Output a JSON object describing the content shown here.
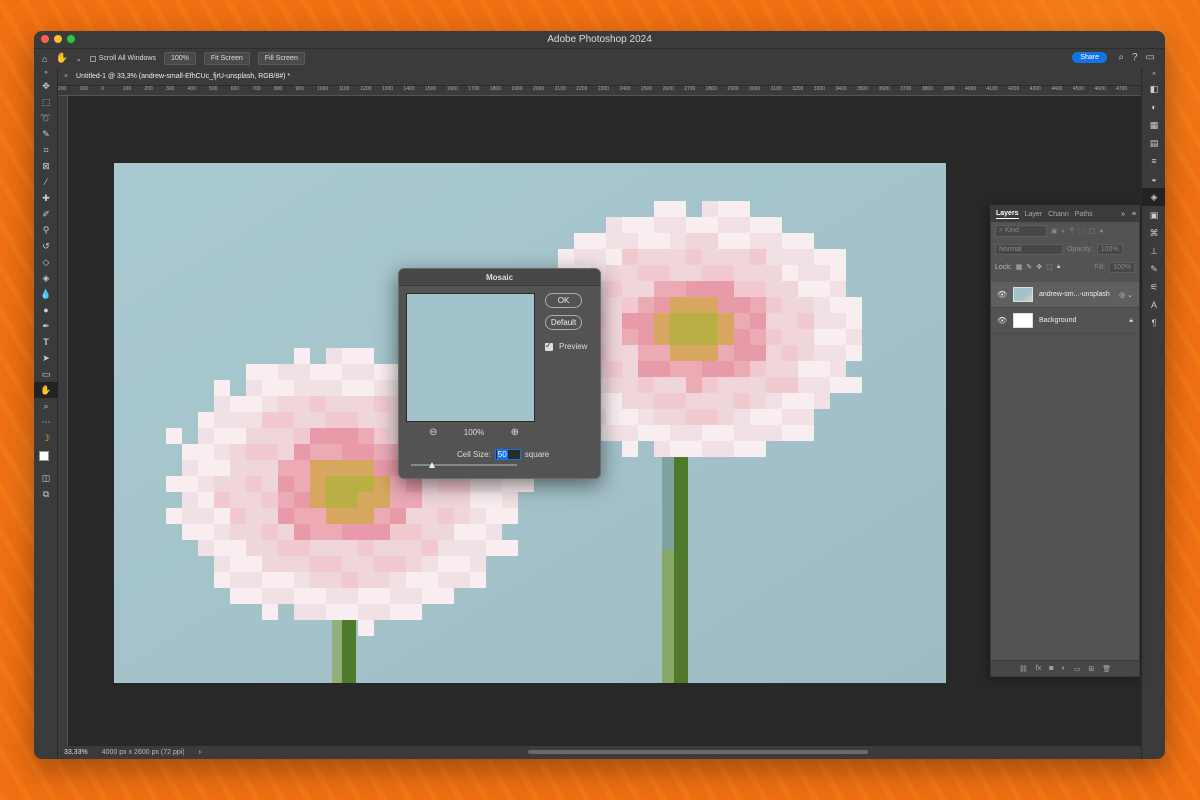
{
  "window": {
    "title": "Adobe Photoshop 2024"
  },
  "options_bar": {
    "scroll_all_windows": "Scroll All Windows",
    "zoom_100": "100%",
    "fit_screen": "Fit Screen",
    "fill_screen": "Fill Screen",
    "share": "Share"
  },
  "document_tab": {
    "title": "Untitled-1 @ 33,3% (andrew-small-EfhCUc_fjrU-unsplash, RGB/8#) *"
  },
  "ruler": {
    "ticks": [
      "200",
      "100",
      "0",
      "100",
      "200",
      "300",
      "400",
      "500",
      "600",
      "700",
      "800",
      "900",
      "1000",
      "1100",
      "1200",
      "1300",
      "1400",
      "1500",
      "1600",
      "1700",
      "1800",
      "1900",
      "2000",
      "2100",
      "2200",
      "2300",
      "2400",
      "2500",
      "2600",
      "2700",
      "2800",
      "2900",
      "3000",
      "3100",
      "3200",
      "3300",
      "3400",
      "3500",
      "3600",
      "3700",
      "3800",
      "3900",
      "4000",
      "4100",
      "4200",
      "4300",
      "4400",
      "4500",
      "4600",
      "4700"
    ]
  },
  "status_bar": {
    "zoom": "33,33%",
    "doc_info": "4000 px x 2600 px (72 ppi)",
    "arrow": "›"
  },
  "mosaic_dialog": {
    "title": "Mosaic",
    "ok": "OK",
    "default": "Default",
    "preview_label": "Preview",
    "preview_zoom": "100%",
    "cell_size_label": "Cell Size:",
    "cell_size_value": "50",
    "cell_size_unit": "square",
    "slider_fraction": 0.2
  },
  "layers_panel": {
    "tabs": [
      "Layers",
      "Layer",
      "Chann",
      "Paths"
    ],
    "kind_placeholder": "Kind",
    "blend_mode": "Normal",
    "opacity_label": "Opacity:",
    "opacity_value": "100%",
    "lock_label": "Lock:",
    "fill_label": "Fill:",
    "fill_value": "100%",
    "layers": [
      {
        "name": "andrew-sm...-unsplash",
        "selected": true
      },
      {
        "name": "Background",
        "selected": false
      }
    ]
  },
  "colors": {
    "background_orange": "#ef6f12",
    "panel": "#535353",
    "chrome": "#3b3b3b",
    "canvas": "#282828",
    "accent_blue": "#1473e6",
    "sky": "#a3c3cb"
  }
}
